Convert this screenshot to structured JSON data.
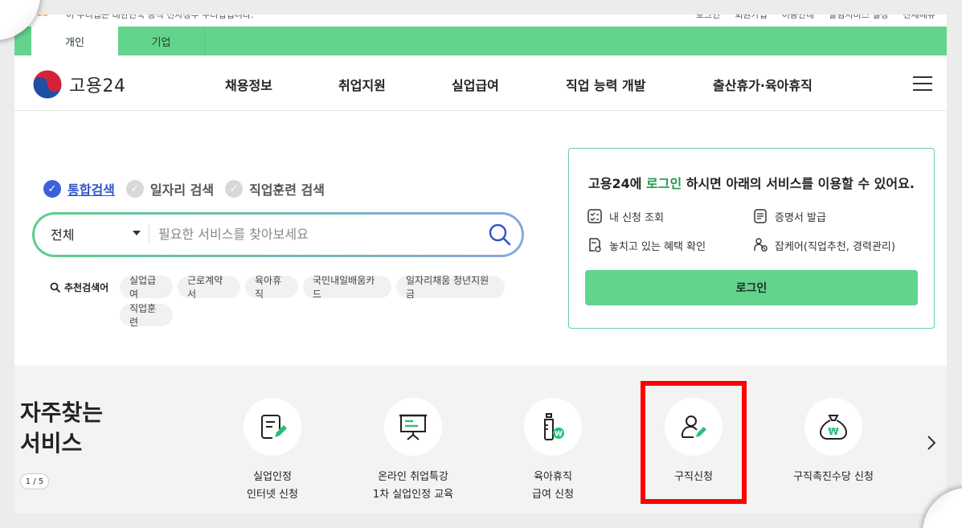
{
  "utility": {
    "gov_mark": "co",
    "gov_notice": "이 누리집은 대한민국 공식 전자정부 누리집입니다.",
    "links": [
      "로그인",
      "회원가입",
      "이용안내",
      "알림서비스 설정",
      "전체메뉴"
    ]
  },
  "audience_tabs": [
    {
      "label": "개인",
      "active": true
    },
    {
      "label": "기업",
      "active": false
    }
  ],
  "header": {
    "logo_text": "고용24",
    "nav": [
      "채용정보",
      "취업지원",
      "실업급여",
      "직업 능력 개발",
      "출산휴가·육아휴직"
    ]
  },
  "search": {
    "types": [
      {
        "label": "통합검색",
        "active": true
      },
      {
        "label": "일자리 검색",
        "active": false
      },
      {
        "label": "직업훈련 검색",
        "active": false
      }
    ],
    "scope": "전체",
    "placeholder": "필요한 서비스를 찾아보세요",
    "recommend_label": "추천검색어",
    "chips": [
      "실업급여",
      "근로계약서",
      "육아휴직",
      "국민내일배움카드",
      "일자리채움 청년지원금",
      "직업훈련"
    ]
  },
  "login_card": {
    "title_pre": "고용24에 ",
    "title_highlight": "로그인",
    "title_post": " 하시면 아래의 서비스를 이용할 수 있어요.",
    "items": [
      "내 신청 조회",
      "증명서 발급",
      "놓치고 있는 혜택 확인",
      "잡케어(직업추천, 경력관리)"
    ],
    "button": "로그인"
  },
  "services": {
    "title_line1": "자주찾는",
    "title_line2": "서비스",
    "pager": "1 / 5",
    "items": [
      {
        "line1": "실업인정",
        "line2": "인터넷 신청",
        "icon": "document-edit-icon"
      },
      {
        "line1": "온라인 취업특강",
        "line2": "1차 실업인정 교육",
        "icon": "presentation-board-icon"
      },
      {
        "line1": "육아휴직",
        "line2": "급여 신청",
        "icon": "baby-bottle-icon"
      },
      {
        "line1": "구직신청",
        "line2": "",
        "icon": "person-edit-icon"
      },
      {
        "line1": "구직촉진수당 신청",
        "line2": "",
        "icon": "money-bag-icon"
      }
    ]
  },
  "colors": {
    "brand_green": "#63d48c",
    "accent_blue": "#3d62d8",
    "highlight_red": "#ff0000",
    "card_border": "#6cc9b4"
  }
}
